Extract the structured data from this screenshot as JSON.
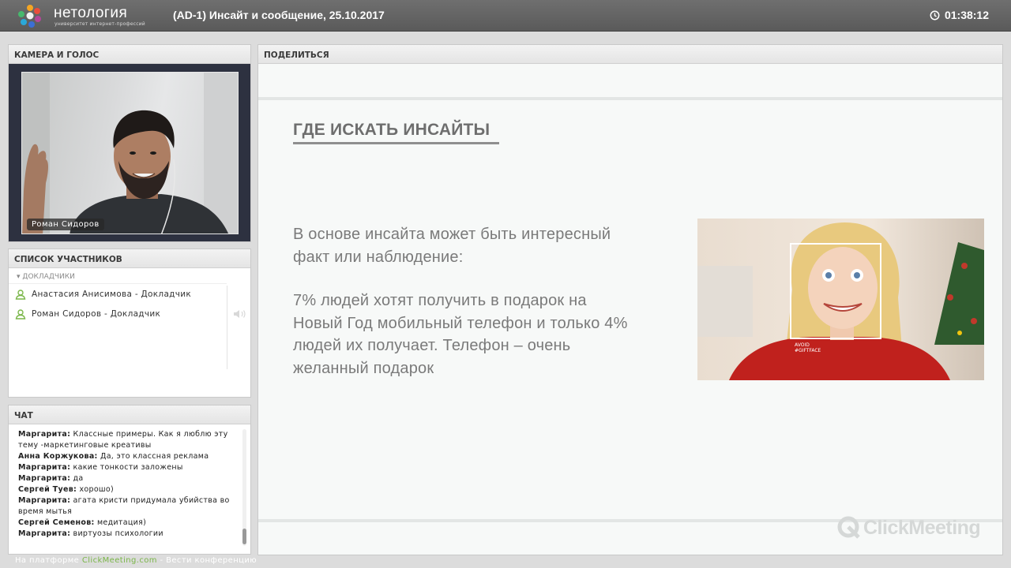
{
  "header": {
    "logo_text": "нетология",
    "logo_subtitle": "университет интернет-профессий",
    "meeting_title": "(AD-1) Инсайт и сообщение, 25.10.2017",
    "timer": "01:38:12"
  },
  "camera": {
    "title": "КАМЕРА И ГОЛОС",
    "presenter_name": "Роман Сидоров"
  },
  "participants": {
    "title": "СПИСОК УЧАСТНИКОВ",
    "group_label": "ДОКЛАДЧИКИ",
    "items": [
      {
        "name": "Анастасия Анисимова  - Докладчик"
      },
      {
        "name": "Роман Сидоров  - Докладчик"
      }
    ]
  },
  "chat": {
    "title": "ЧАТ",
    "messages": [
      {
        "author": "Маргарита:",
        "text": "Классные примеры. Как я люблю  эту тему   -маркетинговые креативы"
      },
      {
        "author": "Анна Коржукова:",
        "text": "Да, это классная реклама"
      },
      {
        "author": "Маргарита:",
        "text": "какие  тонкости  заложены"
      },
      {
        "author": "Маргарита:",
        "text": "да"
      },
      {
        "author": "Сергей Туев:",
        "text": "хорошо)"
      },
      {
        "author": "Маргарита:",
        "text": "агата кристи придумала  убийства  во время мытья"
      },
      {
        "author": "Сергей Семенов:",
        "text": "медитация)"
      },
      {
        "author": "Маргарита:",
        "text": "виртуозы психологии"
      }
    ]
  },
  "footer": {
    "prefix": "На платформе",
    "link": "ClickMeeting.com",
    "suffix": "- Вести конференцию"
  },
  "share": {
    "title": "ПОДЕЛИТЬСЯ",
    "slide": {
      "heading": "ГДЕ ИСКАТЬ ИНСАЙТЫ",
      "paragraph1_line1": "В основе инсайта может быть интересный",
      "paragraph1_line2": "факт или наблюдение:",
      "paragraph2_line1": "7% людей хотят получить в подарок на",
      "paragraph2_line2": "Новый Год мобильный телефон и только 4%",
      "paragraph2_line3": "людей их получает. Телефон – очень",
      "paragraph2_line4": "желанный подарок",
      "image_caption_line1": "AVOID",
      "image_caption_line2": "#GIFTFACE"
    },
    "watermark": "ClickMeeting"
  },
  "colors": {
    "topbar": "#626262",
    "accent_green": "#7ab648",
    "panel_bg": "#ffffff",
    "camera_bg": "#2d3140"
  }
}
